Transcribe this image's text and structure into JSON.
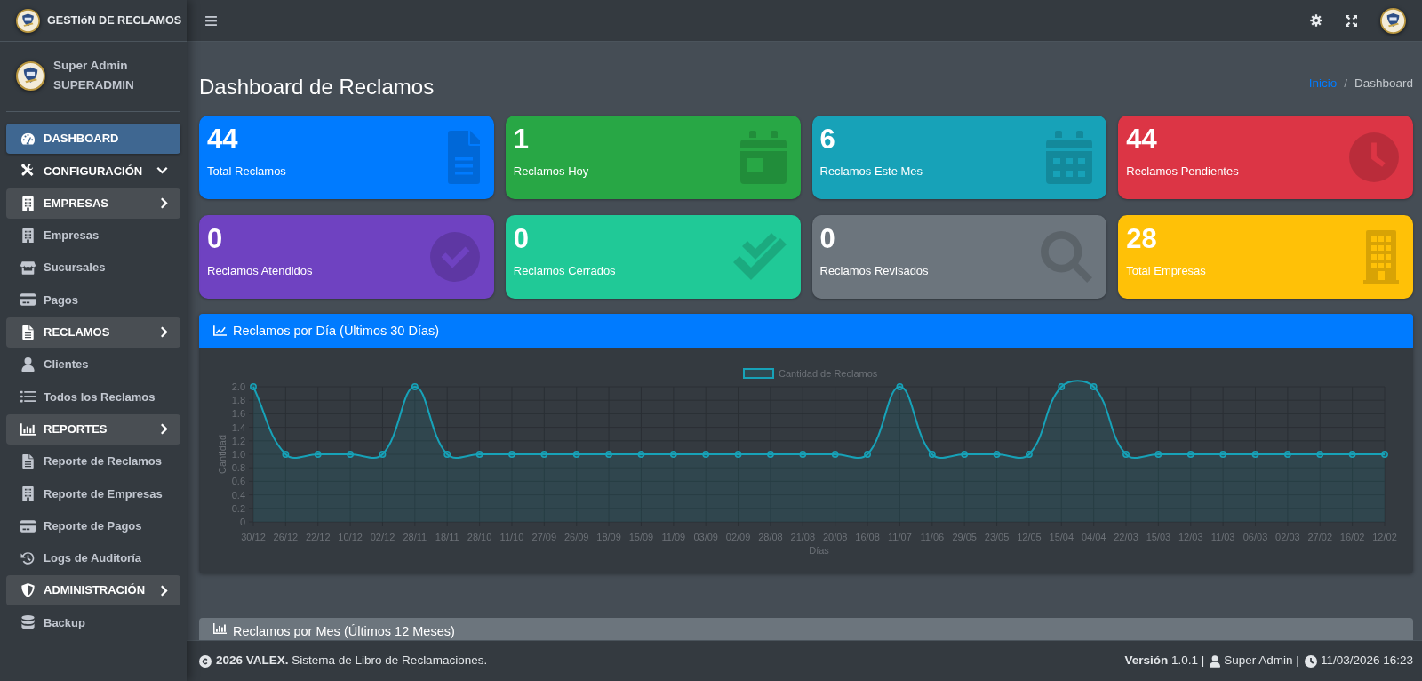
{
  "brand": {
    "title": "GESTIóN DE RECLAMOS"
  },
  "user_panel": {
    "name": "Super Admin",
    "role": "SUPERADMIN"
  },
  "sidebar": {
    "items": [
      {
        "kind": "link",
        "label": "DASHBOARD",
        "selected": true
      },
      {
        "kind": "dropdown",
        "label": "CONFIGURACIÓN",
        "selected": false
      },
      {
        "kind": "section",
        "label": "EMPRESAS",
        "selected": false,
        "children": [
          {
            "label": "Empresas",
            "selected": false
          },
          {
            "label": "Sucursales",
            "selected": false
          },
          {
            "label": "Pagos",
            "selected": false
          }
        ]
      },
      {
        "kind": "section",
        "label": "RECLAMOS",
        "selected": false,
        "children": [
          {
            "label": "Clientes",
            "selected": false
          },
          {
            "label": "Todos los Reclamos",
            "selected": false
          }
        ]
      },
      {
        "kind": "section",
        "label": "REPORTES",
        "selected": false,
        "children": [
          {
            "label": "Reporte de Reclamos",
            "selected": false
          },
          {
            "label": "Reporte de Empresas",
            "selected": false
          },
          {
            "label": "Reporte de Pagos",
            "selected": false
          },
          {
            "label": "Logs de Auditoría",
            "selected": false
          }
        ]
      },
      {
        "kind": "section",
        "label": "ADMINISTRACIÓN",
        "selected": false,
        "children": [
          {
            "label": "Backup",
            "selected": false
          }
        ]
      }
    ]
  },
  "page": {
    "title": "Dashboard de Reclamos",
    "breadcrumb": {
      "separator": "/",
      "items": [
        {
          "label": "Inicio",
          "selected": false
        },
        {
          "label": "Dashboard",
          "selected": true
        }
      ]
    }
  },
  "stats": [
    {
      "value": "44",
      "label": "Total Reclamos",
      "color": "#007bff"
    },
    {
      "value": "1",
      "label": "Reclamos Hoy",
      "color": "#28a745"
    },
    {
      "value": "6",
      "label": "Reclamos Este Mes",
      "color": "#17a2b8"
    },
    {
      "value": "44",
      "label": "Reclamos Pendientes",
      "color": "#dc3545"
    },
    {
      "value": "0",
      "label": "Reclamos Atendidos",
      "color": "#6f42c1"
    },
    {
      "value": "0",
      "label": "Reclamos Cerrados",
      "color": "#20c997"
    },
    {
      "value": "0",
      "label": "Reclamos Revisados",
      "color": "#6c757d"
    },
    {
      "value": "28",
      "label": "Total Empresas",
      "color": "#ffc107"
    }
  ],
  "panels": [
    {
      "title": "Reclamos por Día (Últimos 30 Días)",
      "color": "#007bff",
      "chart_data": {
        "type": "area",
        "grid": true,
        "xlabel": "Días",
        "ylabel": "Cantidad",
        "categories": [
          "30/12",
          "26/12",
          "22/12",
          "10/12",
          "02/12",
          "28/11",
          "18/11",
          "28/10",
          "11/10",
          "27/09",
          "26/09",
          "18/09",
          "15/09",
          "11/09",
          "03/09",
          "02/09",
          "28/08",
          "21/08",
          "20/08",
          "16/08",
          "11/07",
          "11/06",
          "29/05",
          "23/05",
          "12/05",
          "15/04",
          "04/04",
          "22/03",
          "15/03",
          "12/03",
          "11/03",
          "06/03",
          "02/03",
          "27/02",
          "16/02",
          "12/02"
        ],
        "series": [
          {
            "name": "Cantidad de Reclamos",
            "color": "#17a2b8",
            "marker": "circle",
            "values": [
              2,
              1,
              1,
              1,
              1,
              2,
              1,
              1,
              1,
              1,
              1,
              1,
              1,
              1,
              1,
              1,
              1,
              1,
              1,
              1,
              2,
              1,
              1,
              1,
              1,
              2,
              2,
              1,
              1,
              1,
              1,
              1,
              1,
              1,
              1,
              1
            ]
          }
        ],
        "ylim": [
          0,
          2
        ],
        "yticks": [
          {
            "value": 0,
            "label": "0"
          },
          {
            "value": 0.2,
            "label": "0.2"
          },
          {
            "value": 0.4,
            "label": "0.4"
          },
          {
            "value": 0.6,
            "label": "0.6"
          },
          {
            "value": 0.8,
            "label": "0.8"
          },
          {
            "value": 1,
            "label": "1.0"
          },
          {
            "value": 1.2,
            "label": "1.2"
          },
          {
            "value": 1.4,
            "label": "1.4"
          },
          {
            "value": 1.6,
            "label": "1.6"
          },
          {
            "value": 1.8,
            "label": "1.8"
          },
          {
            "value": 2,
            "label": "2.0"
          }
        ]
      }
    },
    {
      "title": "Reclamos por Mes (Últimos 12 Meses)",
      "color": "#6c757d"
    }
  ],
  "footer": {
    "copyright": "**2026 VALEX.** Sistema de Libro de Reclamaciones.",
    "version": "**Versión** 1.0.1 |",
    "user": "Super Admin |",
    "datetime": "11/03/2026 16:23"
  }
}
